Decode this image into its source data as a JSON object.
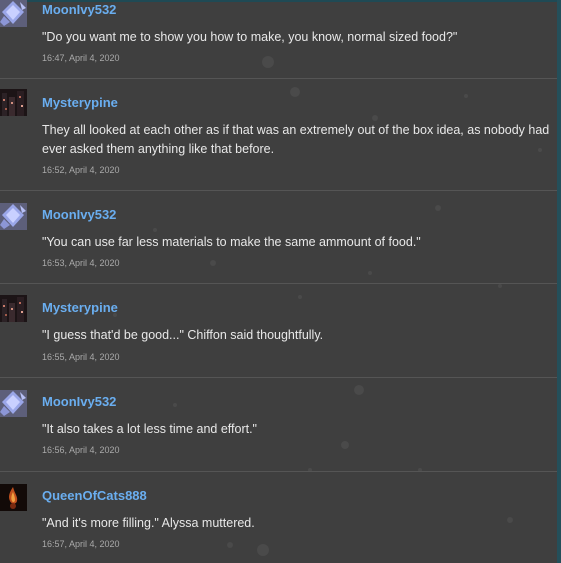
{
  "comments": [
    {
      "author": "MoonIvy532",
      "avatar": "crystal-avatar-icon",
      "text": "\"Do you want me to show you how to make, you know, normal sized food?\"",
      "time": "16:47, April 4, 2020"
    },
    {
      "author": "Mysterypine",
      "avatar": "dark-city-avatar-icon",
      "text": "They all looked at each other as if that was an extremely out of the box idea, as nobody had ever asked them anything like that before.",
      "time": "16:52, April 4, 2020"
    },
    {
      "author": "MoonIvy532",
      "avatar": "crystal-avatar-icon",
      "text": "\"You can use far less materials to make the same ammount of food.\"",
      "time": "16:53, April 4, 2020"
    },
    {
      "author": "Mysterypine",
      "avatar": "dark-city-avatar-icon",
      "text": "\"I guess that'd be good...\" Chiffon said thoughtfully.",
      "time": "16:55, April 4, 2020"
    },
    {
      "author": "MoonIvy532",
      "avatar": "crystal-avatar-icon",
      "text": "\"It also takes a lot less time and effort.\"",
      "time": "16:56, April 4, 2020"
    },
    {
      "author": "QueenOfCats888",
      "avatar": "flame-avatar-icon",
      "text": "\"And it's more filling.\" Alyssa muttered.",
      "time": "16:57, April 4, 2020"
    }
  ]
}
